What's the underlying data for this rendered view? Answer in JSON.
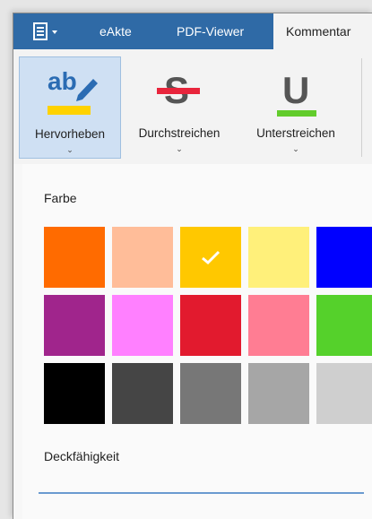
{
  "tabs": [
    {
      "label": "eAkte"
    },
    {
      "label": "PDF-Viewer"
    },
    {
      "label": "Kommentar"
    }
  ],
  "ribbon": {
    "buttons": [
      {
        "label": "Hervorheben"
      },
      {
        "label": "Durchstreichen"
      },
      {
        "label": "Unterstreichen"
      }
    ]
  },
  "colors": {
    "tabbar": "#2f6aa6",
    "highlight_yellow": "#ffd200",
    "strike_red": "#e8253c",
    "underline_green": "#62cc2c"
  },
  "dropdown": {
    "color_label": "Farbe",
    "opacity_label": "Deckfähigkeit",
    "selected_color": "#ffc800",
    "palette": [
      [
        "#ff6b00",
        "#ffbd99",
        "#ffc800",
        "#fff07a",
        "#0000ff"
      ],
      [
        "#a0258c",
        "#ff80ff",
        "#e21a2e",
        "#ff7d93",
        "#55d12b"
      ],
      [
        "#000000",
        "#454545",
        "#777777",
        "#a6a6a6",
        "#cfcfcf"
      ]
    ]
  }
}
